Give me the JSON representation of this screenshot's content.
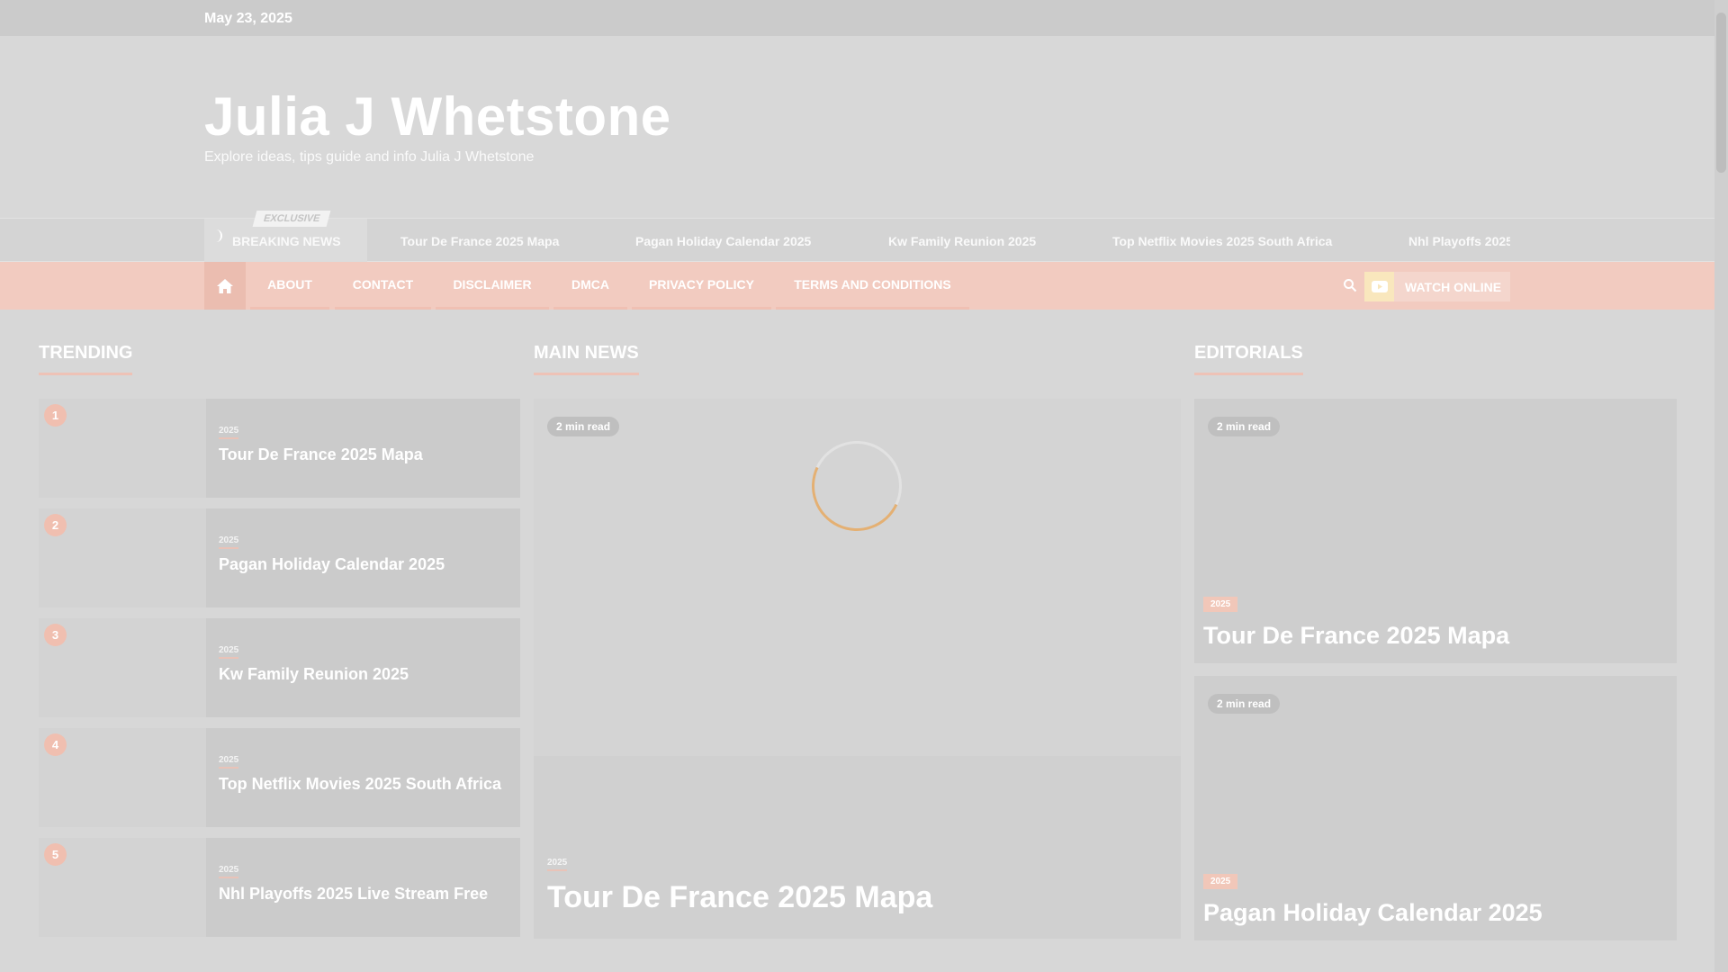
{
  "topbar": {
    "date": "May 23, 2025"
  },
  "header": {
    "title": "Julia J Whetstone",
    "tagline": "Explore ideas, tips guide and info Julia J Whetstone"
  },
  "breaking": {
    "exclusive": "EXCLUSIVE",
    "label": "BREAKING NEWS",
    "items": [
      "Tour De France 2025 Mapa",
      "Pagan Holiday Calendar 2025",
      "Kw Family Reunion 2025",
      "Top Netflix Movies 2025 South Africa",
      "Nhl Playoffs 2025"
    ]
  },
  "nav": {
    "items": [
      "ABOUT",
      "CONTACT",
      "DISCLAIMER",
      "DMCA",
      "PRIVACY POLICY",
      "TERMS AND CONDITIONS"
    ],
    "watch_label": "WATCH ONLINE"
  },
  "trending": {
    "title": "TRENDING",
    "items": [
      {
        "num": "1",
        "cat": "2025",
        "title": "Tour De France 2025 Mapa"
      },
      {
        "num": "2",
        "cat": "2025",
        "title": "Pagan Holiday Calendar 2025"
      },
      {
        "num": "3",
        "cat": "2025",
        "title": "Kw Family Reunion 2025"
      },
      {
        "num": "4",
        "cat": "2025",
        "title": "Top Netflix Movies 2025 South Africa"
      },
      {
        "num": "5",
        "cat": "2025",
        "title": "Nhl Playoffs 2025 Live Stream Free"
      }
    ]
  },
  "main_news": {
    "title": "MAIN NEWS",
    "read": "2 min read",
    "cat": "2025",
    "headline": "Tour De France 2025 Mapa"
  },
  "editorials": {
    "title": "EDITORIALS",
    "items": [
      {
        "read": "2 min read",
        "cat": "2025",
        "title": "Tour De France 2025 Mapa"
      },
      {
        "read": "2 min read",
        "cat": "2025",
        "title": "Pagan Holiday Calendar 2025"
      }
    ]
  },
  "colors": {
    "accent": "#f0bfb0",
    "underline": "#eec2b6",
    "loader": "#e4b073"
  }
}
